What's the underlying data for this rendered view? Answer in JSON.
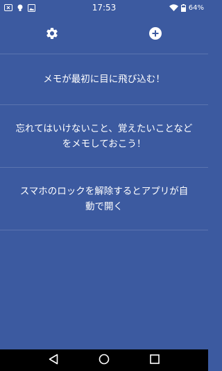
{
  "status_bar": {
    "time": "17:53",
    "battery": "64%",
    "icons": [
      "notification-x-icon",
      "lightbulb-icon",
      "image-icon",
      "wifi-icon",
      "battery-icon"
    ]
  },
  "toolbar": {
    "settings_icon": "gear-icon",
    "add_icon": "plus-circle-icon"
  },
  "memos": [
    {
      "text": "メモが最初に目に飛び込む！"
    },
    {
      "text": "忘れてはいけないこと、覚えたいことなどをメモしておこう！"
    },
    {
      "text": "スマホのロックを解除するとアプリが自動で開く"
    }
  ],
  "nav_bar": {
    "icons": [
      "back-icon",
      "home-icon",
      "recents-icon"
    ]
  },
  "colors": {
    "background": "#3c5aa0",
    "divider": "rgba(255,255,255,0.16)",
    "nav_bar": "#000000",
    "text": "#ffffff"
  }
}
